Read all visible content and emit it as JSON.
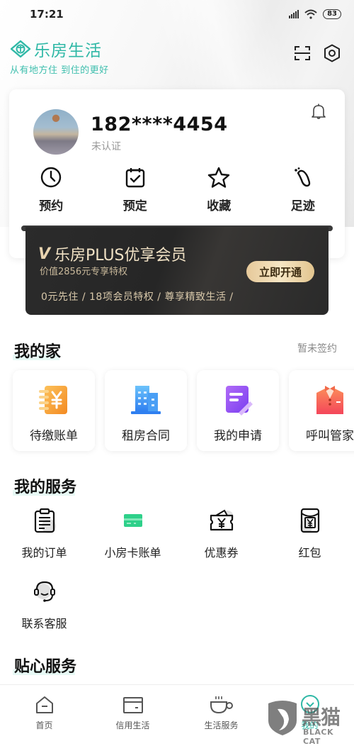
{
  "status_bar": {
    "time": "17:21",
    "battery": "83"
  },
  "brand": {
    "name": "乐房生活",
    "slogan": "从有地方住  到住的更好"
  },
  "top_icons": [
    "scan-icon",
    "settings-icon"
  ],
  "profile": {
    "phone": "182****4454",
    "verify_status": "未认证",
    "quick_actions": [
      {
        "label": "预约",
        "icon": "clock-icon"
      },
      {
        "label": "预定",
        "icon": "calendar-check-icon"
      },
      {
        "label": "收藏",
        "icon": "star-icon"
      },
      {
        "label": "足迹",
        "icon": "footprint-icon"
      }
    ]
  },
  "plus": {
    "title": "乐房PLUS优享会员",
    "subtitle": "价值2856元专享特权",
    "features": "0元先住 / 18项会员特权 / 尊享精致生活 /",
    "button": "立即开通",
    "accent": "#e6c99a"
  },
  "my_home": {
    "title": "我的家",
    "status": "暂未签约",
    "items": [
      {
        "label": "待缴账单",
        "icon": "bill-icon",
        "color": "#f7a33b"
      },
      {
        "label": "租房合同",
        "icon": "building-icon",
        "color": "#3a8ef0"
      },
      {
        "label": "我的申请",
        "icon": "application-icon",
        "color": "#8a4ef0"
      },
      {
        "label": "呼叫管家",
        "icon": "butler-icon",
        "color": "#f45a5a"
      }
    ]
  },
  "my_services": {
    "title": "我的服务",
    "items": [
      {
        "label": "我的订单",
        "icon": "order-icon"
      },
      {
        "label": "小房卡账单",
        "icon": "card-icon"
      },
      {
        "label": "优惠券",
        "icon": "coupon-icon"
      },
      {
        "label": "红包",
        "icon": "red-packet-icon"
      },
      {
        "label": "联系客服",
        "icon": "headset-icon"
      }
    ]
  },
  "care_services": {
    "title": "贴心服务"
  },
  "tabbar": [
    {
      "label": "首页",
      "icon": "home-icon"
    },
    {
      "label": "信用生活",
      "icon": "credit-card-icon"
    },
    {
      "label": "生活服务",
      "icon": "coffee-icon"
    },
    {
      "label": "我的",
      "icon": "profile-icon",
      "active": true
    }
  ],
  "watermark": {
    "cn": "黑猫",
    "en": "BLACK CAT"
  },
  "colors": {
    "brand": "#2fb8a6",
    "card_dark": "#2b2b2b"
  }
}
